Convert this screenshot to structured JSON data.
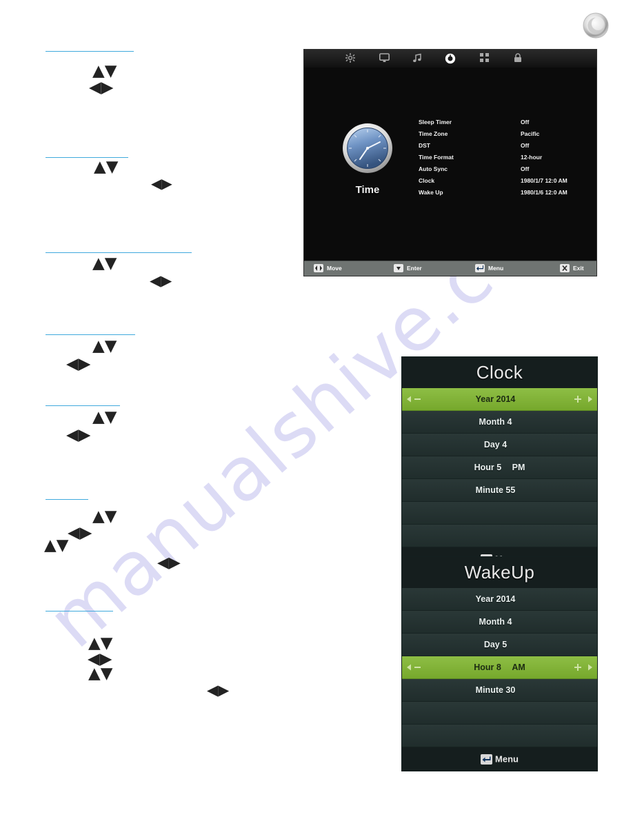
{
  "page": {
    "watermark": "manualshive.com",
    "brand_logo_icon": "circular-chrome-logo-icon"
  },
  "instructions": {
    "sections": [
      {
        "name": "sleep-timer",
        "body": "",
        "arrow_clusters": [
          "up-down",
          "left-right"
        ]
      },
      {
        "name": "time-zone",
        "body": "",
        "arrow_clusters": [
          "up-down",
          "left-right"
        ]
      },
      {
        "name": "daylight-saving-time",
        "body": "",
        "arrow_clusters": [
          "up-down",
          "left-right"
        ]
      },
      {
        "name": "time-format",
        "body": "",
        "arrow_clusters": [
          "up-down",
          "left-right"
        ]
      },
      {
        "name": "auto-sync",
        "body": "",
        "arrow_clusters": [
          "up-down",
          "left-right"
        ]
      },
      {
        "name": "clock",
        "body": "",
        "arrow_clusters": [
          "up-down",
          "left-right",
          "up-down",
          "left-right"
        ]
      },
      {
        "name": "wake-up",
        "body": "",
        "arrow_clusters": [
          "up-down",
          "left-right",
          "up-down",
          "left-right"
        ]
      }
    ]
  },
  "osd": {
    "nav_icons": [
      {
        "name": "settings-gear-icon",
        "selected": false
      },
      {
        "name": "picture-monitor-icon",
        "selected": false
      },
      {
        "name": "audio-music-note-icon",
        "selected": false
      },
      {
        "name": "time-clock-icon",
        "selected": true
      },
      {
        "name": "apps-grid-icon",
        "selected": false
      },
      {
        "name": "parental-lock-icon",
        "selected": false
      }
    ],
    "category": {
      "icon": "analog-clock-icon",
      "label": "Time"
    },
    "settings": [
      {
        "label": "Sleep Timer",
        "value": "Off"
      },
      {
        "label": "Time Zone",
        "value": "Pacific"
      },
      {
        "label": "DST",
        "value": "Off"
      },
      {
        "label": "Time Format",
        "value": "12-hour"
      },
      {
        "label": "Auto Sync",
        "value": "Off"
      },
      {
        "label": "Clock",
        "value": "1980/1/7 12:0 AM"
      },
      {
        "label": "Wake Up",
        "value": "1980/1/6 12:0 AM"
      }
    ],
    "hints": [
      {
        "key_icon": "left-right-key-icon",
        "label": "Move"
      },
      {
        "key_icon": "down-key-icon",
        "label": "Enter"
      },
      {
        "key_icon": "return-key-icon",
        "label": "Menu"
      },
      {
        "key_icon": "exit-key-icon",
        "label": "Exit"
      }
    ]
  },
  "clock_panel": {
    "title": "Clock",
    "rows": [
      {
        "label": "Year 2014",
        "ampm": "",
        "selected": true
      },
      {
        "label": "Month 4",
        "ampm": "",
        "selected": false
      },
      {
        "label": "Day 4",
        "ampm": "",
        "selected": false
      },
      {
        "label": "Hour 5",
        "ampm": "PM",
        "selected": false
      },
      {
        "label": "Minute 55",
        "ampm": "",
        "selected": false
      }
    ],
    "footer_label": "Menu",
    "footer_icon": "return-key-icon"
  },
  "wakeup_panel": {
    "title": "WakeUp",
    "rows": [
      {
        "label": "Year 2014",
        "ampm": "",
        "selected": false
      },
      {
        "label": "Month 4",
        "ampm": "",
        "selected": false
      },
      {
        "label": "Day 5",
        "ampm": "",
        "selected": false
      },
      {
        "label": "Hour 8",
        "ampm": "AM",
        "selected": true
      },
      {
        "label": "Minute 30",
        "ampm": "",
        "selected": false
      }
    ],
    "footer_label": "Menu",
    "footer_icon": "return-key-icon"
  },
  "colors": {
    "heading_rule": "#3fa9dd",
    "highlight_green": "#7fae33",
    "panel_dark": "#22302f",
    "osd_black": "#0b0b0b",
    "osd_bar_gray": "#6f7472",
    "watermark": "#c8c6ef"
  }
}
